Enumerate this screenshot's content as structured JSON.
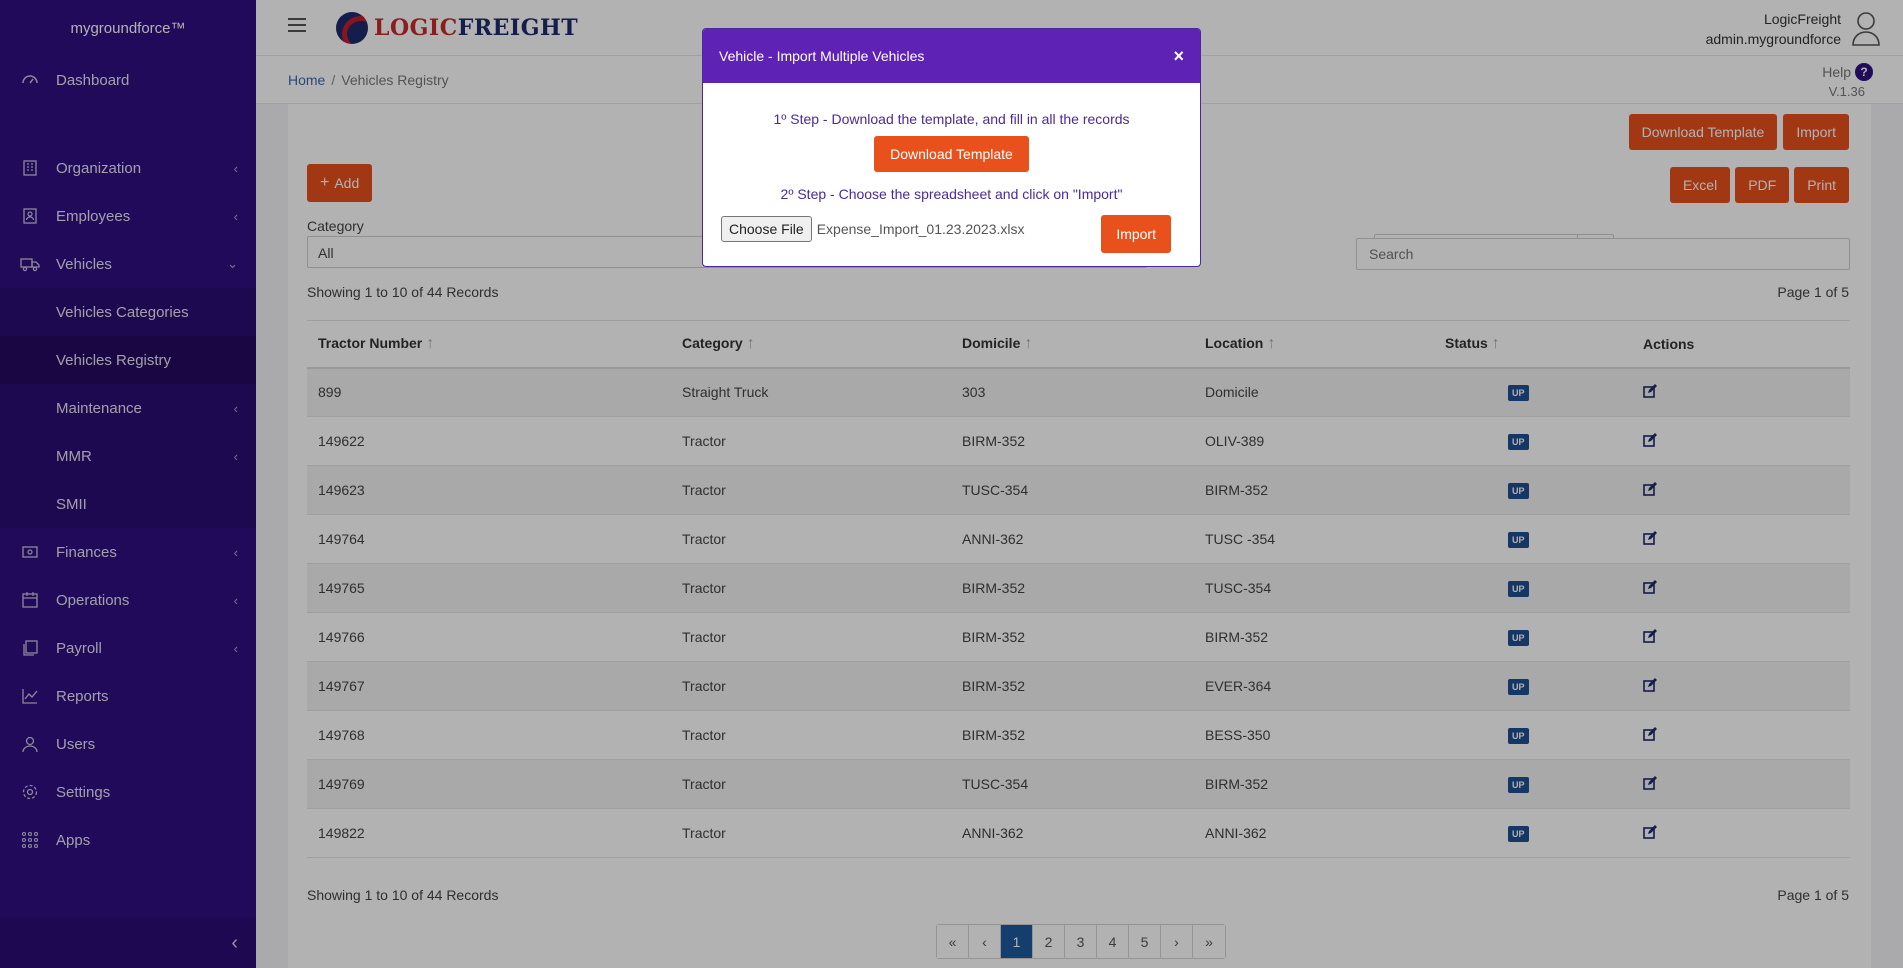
{
  "sidebar": {
    "brand": "mygroundforce™",
    "items": [
      {
        "label": "Dashboard",
        "icon": "dashboard-icon",
        "has_children": false
      },
      {
        "label": "Organization",
        "icon": "organization-icon",
        "has_children": true
      },
      {
        "label": "Employees",
        "icon": "employees-icon",
        "has_children": true
      },
      {
        "label": "Vehicles",
        "icon": "vehicles-icon",
        "has_children": true,
        "expanded": true
      },
      {
        "label": "Vehicles Categories",
        "sub": true
      },
      {
        "label": "Vehicles Registry",
        "sub": true,
        "active": true
      },
      {
        "label": "Maintenance",
        "sub": true,
        "has_children": true
      },
      {
        "label": "MMR",
        "sub": true,
        "has_children": true
      },
      {
        "label": "SMII",
        "sub": true
      },
      {
        "label": "Finances",
        "icon": "finances-icon",
        "has_children": true
      },
      {
        "label": "Operations",
        "icon": "operations-icon",
        "has_children": true
      },
      {
        "label": "Payroll",
        "icon": "payroll-icon",
        "has_children": true
      },
      {
        "label": "Reports",
        "icon": "reports-icon",
        "has_children": false
      },
      {
        "label": "Users",
        "icon": "users-icon",
        "has_children": false
      },
      {
        "label": "Settings",
        "icon": "settings-icon",
        "has_children": false
      },
      {
        "label": "Apps",
        "icon": "apps-icon",
        "has_children": false
      }
    ]
  },
  "header": {
    "logo_part1": "LOGIC",
    "logo_part2": "FREIGHT",
    "company": "LogicFreight",
    "username": "admin.mygroundforce"
  },
  "breadcrumb": {
    "home": "Home",
    "current": "Vehicles Registry"
  },
  "help": {
    "label": "Help",
    "version": "V.1.36"
  },
  "toolbar": {
    "download_template": "Download Template",
    "import": "Import",
    "add": "Add",
    "excel": "Excel",
    "pdf": "PDF",
    "print": "Print"
  },
  "filters": {
    "category_label": "Category",
    "category_value": "All",
    "search_placeholder": "Search"
  },
  "table": {
    "showing": "Showing 1 to 10 of 44 Records",
    "page_info": "Page 1 of 5",
    "columns": [
      "Tractor Number",
      "Category",
      "Domicile",
      "Location",
      "Status",
      "Actions"
    ],
    "rows": [
      {
        "number": "899",
        "category": "Straight Truck",
        "domicile": "303",
        "location": "Domicile",
        "status": "UP"
      },
      {
        "number": "149622",
        "category": "Tractor",
        "domicile": "BIRM-352",
        "location": "OLIV-389",
        "status": "UP"
      },
      {
        "number": "149623",
        "category": "Tractor",
        "domicile": "TUSC-354",
        "location": "BIRM-352",
        "status": "UP"
      },
      {
        "number": "149764",
        "category": "Tractor",
        "domicile": "ANNI-362",
        "location": "TUSC -354",
        "status": "UP"
      },
      {
        "number": "149765",
        "category": "Tractor",
        "domicile": "BIRM-352",
        "location": "TUSC-354",
        "status": "UP"
      },
      {
        "number": "149766",
        "category": "Tractor",
        "domicile": "BIRM-352",
        "location": "BIRM-352",
        "status": "UP"
      },
      {
        "number": "149767",
        "category": "Tractor",
        "domicile": "BIRM-352",
        "location": "EVER-364",
        "status": "UP"
      },
      {
        "number": "149768",
        "category": "Tractor",
        "domicile": "BIRM-352",
        "location": "BESS-350",
        "status": "UP"
      },
      {
        "number": "149769",
        "category": "Tractor",
        "domicile": "TUSC-354",
        "location": "BIRM-352",
        "status": "UP"
      },
      {
        "number": "149822",
        "category": "Tractor",
        "domicile": "ANNI-362",
        "location": "ANNI-362",
        "status": "UP"
      }
    ]
  },
  "pagination": {
    "first": "«",
    "prev": "‹",
    "pages": [
      "1",
      "2",
      "3",
      "4",
      "5"
    ],
    "current": "1",
    "next": "›",
    "last": "»"
  },
  "modal": {
    "title": "Vehicle - Import Multiple Vehicles",
    "close": "×",
    "step1": "1º Step - Download the template, and fill in all the records",
    "download_button": "Download Template",
    "step2": "2º Step - Choose the spreadsheet and click on \"Import\"",
    "choose_file": "Choose File",
    "file_name": "Expense_Import_01.23.2023.xlsx",
    "import_button": "Import"
  },
  "colors": {
    "sidebar": "#2f0f80",
    "accent": "#e8501c",
    "modal_header": "#5e22b4",
    "badge": "#1d4f91"
  }
}
